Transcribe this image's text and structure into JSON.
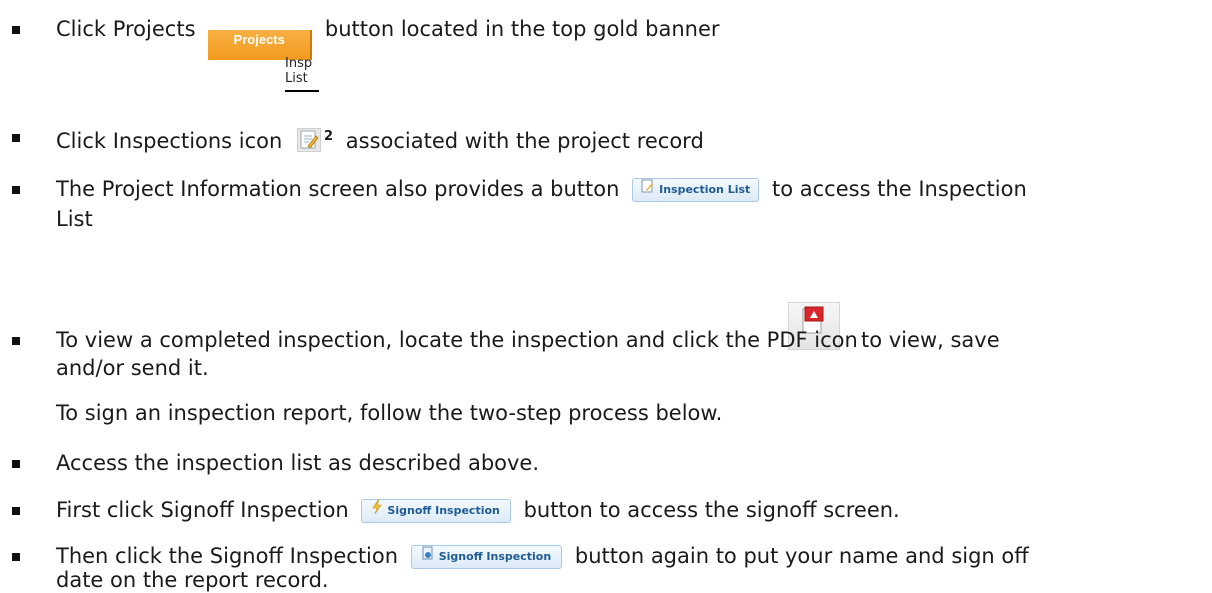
{
  "steps": {
    "s1_pre": "Click Projects",
    "s1_btn": "Projects",
    "s1_post": "button located in the top gold banner",
    "insp_list_line1": "Insp",
    "insp_list_line2": "List",
    "s2_pre": "Click Inspections icon",
    "s2_sup": "2",
    "s2_post": "associated with the project record",
    "s3_pre": "The Project Information screen also provides a button",
    "s3_btn": "Inspection List",
    "s3_post": "to access the Inspection",
    "s3_line2": "List",
    "s4_pre": "To view a completed inspection, locate the inspection and click the PDF icon",
    "s4_post": "to view, save",
    "s4_line2": "and/or send it.",
    "note": "To sign an inspection report, follow the two-step process below.",
    "s5": "Access the inspection list as described above.",
    "s6_pre": "First click Signoff Inspection",
    "s6_btn": "Signoff Inspection",
    "s6_post": "button to access the signoff screen.",
    "s7_pre": "Then click the Signoff Inspection",
    "s7_btn": "Signoff Inspection",
    "s7_post": "button again to put your name and sign off",
    "s7_line2": "date on the report record."
  },
  "colors": {
    "projects_button": "#f29a1d",
    "blue_button_text": "#1f5b96",
    "pdf_red": "#d8262b"
  },
  "icons": [
    "edit-inspection-icon",
    "document-icon",
    "lightning-icon",
    "signoff-doc-icon",
    "pdf-icon"
  ]
}
